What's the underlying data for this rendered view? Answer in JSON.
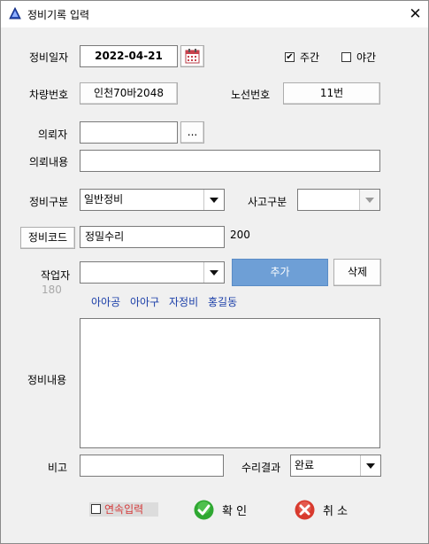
{
  "window": {
    "title": "정비기록 입력"
  },
  "form": {
    "date_label": "정비일자",
    "date_value": "2022-04-21",
    "day_shift_label": "주간",
    "day_shift_checked": true,
    "night_shift_label": "야간",
    "night_shift_checked": false,
    "vehicle_label": "차량번호",
    "vehicle_value": "인천70바2048",
    "route_label": "노선번호",
    "route_value": "11번",
    "requester_label": "의뢰자",
    "requester_value": "",
    "requester_lookup": "...",
    "request_content_label": "의뢰내용",
    "request_content_value": "",
    "maint_type_label": "정비구분",
    "maint_type_value": "일반정비",
    "accident_type_label": "사고구분",
    "accident_type_value": "",
    "maint_code_button": "정비코드",
    "maint_code_value": "정밀수리",
    "maint_code_number": "200",
    "worker_label": "작업자",
    "worker_value": "",
    "worker_code": "180",
    "add_button": "추가",
    "delete_button": "삭제",
    "workers": [
      "아아공",
      "아아구",
      "자정비",
      "홍길동"
    ],
    "maint_detail_label": "정비내용",
    "maint_detail_value": "",
    "remark_label": "비고",
    "remark_value": "",
    "repair_result_label": "수리결과",
    "repair_result_value": "완료",
    "continuous_label": "연속입력",
    "continuous_checked": false,
    "ok_button": "확 인",
    "cancel_button": "취 소"
  },
  "colors": {
    "accent_button": "#6e9fd6",
    "member_text": "#1a3ea8",
    "ok_icon": "#2fa832",
    "cancel_icon": "#d83a2e",
    "continuous_highlight": "#d43a3a"
  }
}
